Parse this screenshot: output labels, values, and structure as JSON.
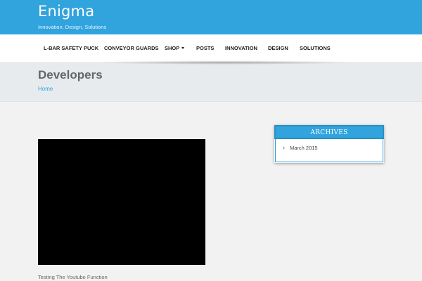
{
  "site": {
    "title": "Enigma",
    "tagline": "Innovation, Design, Solutions"
  },
  "nav": {
    "items": [
      {
        "label": "L-BAR SAFETY PUCK"
      },
      {
        "label": "CONVEYOR GUARDS"
      },
      {
        "label": "SHOP",
        "has_dropdown": true
      },
      {
        "label": "POSTS"
      },
      {
        "label": "INNOVATION"
      },
      {
        "label": "DESIGN"
      },
      {
        "label": "SOLUTIONS"
      }
    ]
  },
  "page": {
    "title": "Developers",
    "breadcrumb": "Home"
  },
  "content": {
    "video_caption": "Testing The Youtube Function"
  },
  "sidebar": {
    "archives": {
      "title": "ARCHIVES",
      "items": [
        {
          "label": "March 2015",
          "icon": "chevron-right-icon"
        }
      ]
    }
  },
  "colors": {
    "brand_blue": "#31a3dd",
    "page_bg": "#f2f2f2",
    "header_band": "#e8ebee"
  }
}
